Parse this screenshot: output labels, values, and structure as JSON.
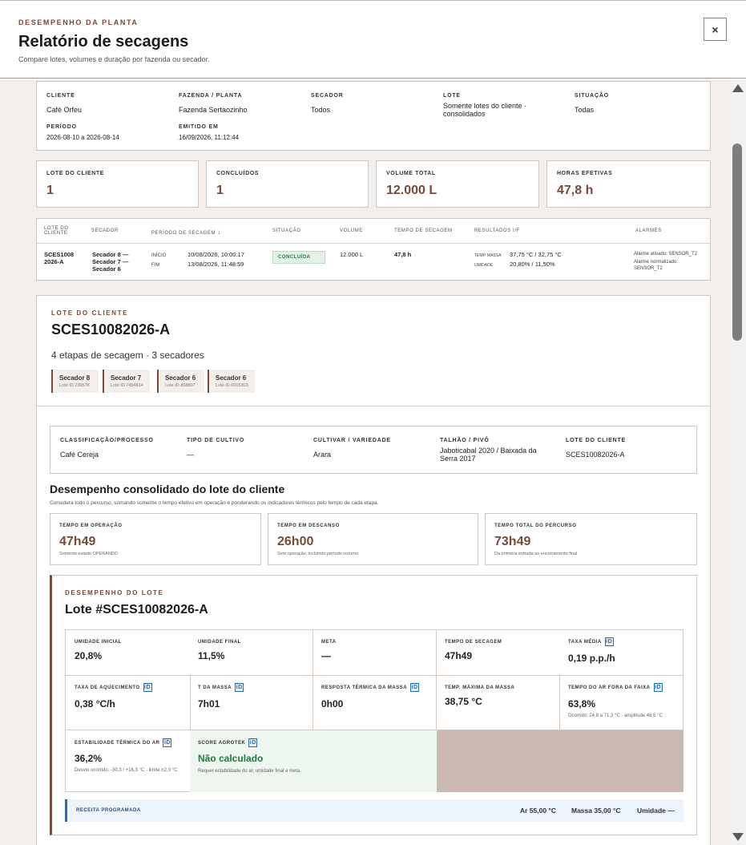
{
  "header": {
    "eyebrow": "DESEMPENHO DA PLANTA",
    "title": "Relatório de secagens",
    "subtitle": "Compare lotes, volumes e duração por fazenda ou secador.",
    "close": "×"
  },
  "filters": {
    "cliente_label": "CLIENTE",
    "cliente": "Café Orfeu",
    "fazenda_label": "FAZENDA / PLANTA",
    "fazenda": "Fazenda Sertaozinho",
    "secador_label": "SECADOR",
    "secador": "Todos",
    "lote_label": "LOTE",
    "lote": "Somente lotes do cliente · consolidados",
    "situacao_label": "SITUAÇÃO",
    "situacao": "Todas",
    "periodo_label": "PERÍODO",
    "periodo": "2026-08-10 a 2026-08-14",
    "emitido_label": "EMITIDO EM",
    "emitido": "16/09/2026, 11:12:44"
  },
  "kpis": [
    {
      "label": "LOTE DO CLIENTE",
      "value": "1"
    },
    {
      "label": "CONCLUÍDOS",
      "value": "1"
    },
    {
      "label": "VOLUME TOTAL",
      "value": "12.000 L"
    },
    {
      "label": "HORAS EFETIVAS",
      "value": "47,8 h"
    }
  ],
  "table": {
    "headers": {
      "lote": "LOTE DO CLIENTE",
      "secador": "SECADOR",
      "periodo": "PERÍODO DE SECAGEM",
      "sort": "↓",
      "situacao": "SITUAÇÃO",
      "volume": "VOLUME",
      "tempo": "TEMPO DE SECAGEM",
      "resultados": "RESULTADOS I/F",
      "alarmes": "ALARMES"
    },
    "row": {
      "lote": "SCES1008 2026-A",
      "secador": "Secador 8 — Secador 7 — Secador 6",
      "inicio_label": "INÍCIO",
      "inicio": "10/08/2026, 10:00:17",
      "fim_label": "FIM",
      "fim": "13/08/2026, 11:48:59",
      "situacao": "CONCLUÍDA",
      "volume": "12.000 L",
      "tempo": "47,8 h",
      "temp_label": "TEMP. MASSA",
      "temp": "37,75 °C / 32,75 °C",
      "umid_label": "UMIDADE",
      "umid": "20,80% / 11,50%",
      "alarme1": "Alarme ativado: SENSOR_T2",
      "alarme2": "Alarme normalizado: SENSOR_T2"
    }
  },
  "lote": {
    "eyebrow": "LOTE DO CLIENTE",
    "code": "SCES10082026-A",
    "summary": "4 etapas de secagem · 3 secadores",
    "chips": [
      {
        "name": "Secador 8",
        "id": "Lote ID 239578"
      },
      {
        "name": "Secador 7",
        "id": "Lote ID 7454614"
      },
      {
        "name": "Secador 6",
        "id": "Lote ID 858807"
      },
      {
        "name": "Secador 6",
        "id": "Lote ID 6015303"
      }
    ],
    "info": {
      "classificacao_label": "CLASSIFICAÇÃO/PROCESSO",
      "classificacao": "Café Cereja",
      "tipo_label": "TIPO DE CULTIVO",
      "tipo": "—",
      "cultivar_label": "CULTIVAR / VARIEDADE",
      "cultivar": "Arara",
      "talhao_label": "TALHÃO / PIVÔ",
      "talhao": "Jaboticabal 2020 / Baixada da Serra 2017",
      "lote_label": "LOTE DO CLIENTE",
      "lote": "SCES10082026-A"
    },
    "consolidado_title": "Desempenho consolidado do lote do cliente",
    "consolidado_sub": "Considera todo o percurso, somando somente o tempo efetivo em operação e ponderando os indicadores térmicos pelo tempo de cada etapa.",
    "tempos": [
      {
        "label": "TEMPO EM OPERAÇÃO",
        "value": "47h49",
        "note": "Somente estado OPERANDO"
      },
      {
        "label": "TEMPO EM DESCANSO",
        "value": "26h00",
        "note": "Sem operação, incluindo período noturno"
      },
      {
        "label": "TEMPO TOTAL DO PERCURSO",
        "value": "73h49",
        "note": "Da primeira entrada ao encerramento final"
      }
    ]
  },
  "desempenho": {
    "eyebrow": "DESEMPENHO DO LOTE",
    "title": "Lote #SCES10082026-A",
    "umid_ini_label": "UMIDADE INICIAL",
    "umid_ini": "20,8%",
    "umid_fin_label": "UMIDADE FINAL",
    "umid_fin": "11,5%",
    "meta_label": "META",
    "meta": "—",
    "tempo_label": "TEMPO DE SECAGEM",
    "tempo": "47h49",
    "taxa_label": "TAXA MÉDIA",
    "taxa": "0,19 p.p./h",
    "aquec_label": "TAXA DE AQUECIMENTO",
    "aquec": "0,38 °C/h",
    "tmassa_label": "T DA MASSA",
    "tmassa": "7h01",
    "resp_label": "RESPOSTA TÉRMICA DA MASSA",
    "resp": "0h00",
    "tmax_label": "TEMP. MÁXIMA DA MASSA",
    "tmax": "38,75 °C",
    "tar_label": "TEMPO DO AR FORA DA FAIXA",
    "tar": "63,8%",
    "tar_note": "Ocorrido: 24,8 a 71,3 °C · amplitude 46,5 °C",
    "estab_label": "ESTABILIDADE TÉRMICA DO AR",
    "estab": "36,2%",
    "estab_note": "Desvio ocorrido: -30,3 / +16,3 °C · limite ±2,0 °C",
    "score_label": "SCORE AGROTEK",
    "score": "Não calculado",
    "score_note": "Requer estabilidade do ar, umidade final e meta.",
    "info_icon": "iD",
    "receita_label": "RECEITA PROGRAMADA",
    "receita_ar": "Ar 55,00 °C",
    "receita_massa": "Massa 35,00 °C",
    "receita_umid": "Umidade —"
  },
  "colors": {
    "accent": "#7a4a35",
    "bg": "#f4efea",
    "success": "#1f7a3d",
    "info": "#2b6cb0"
  }
}
